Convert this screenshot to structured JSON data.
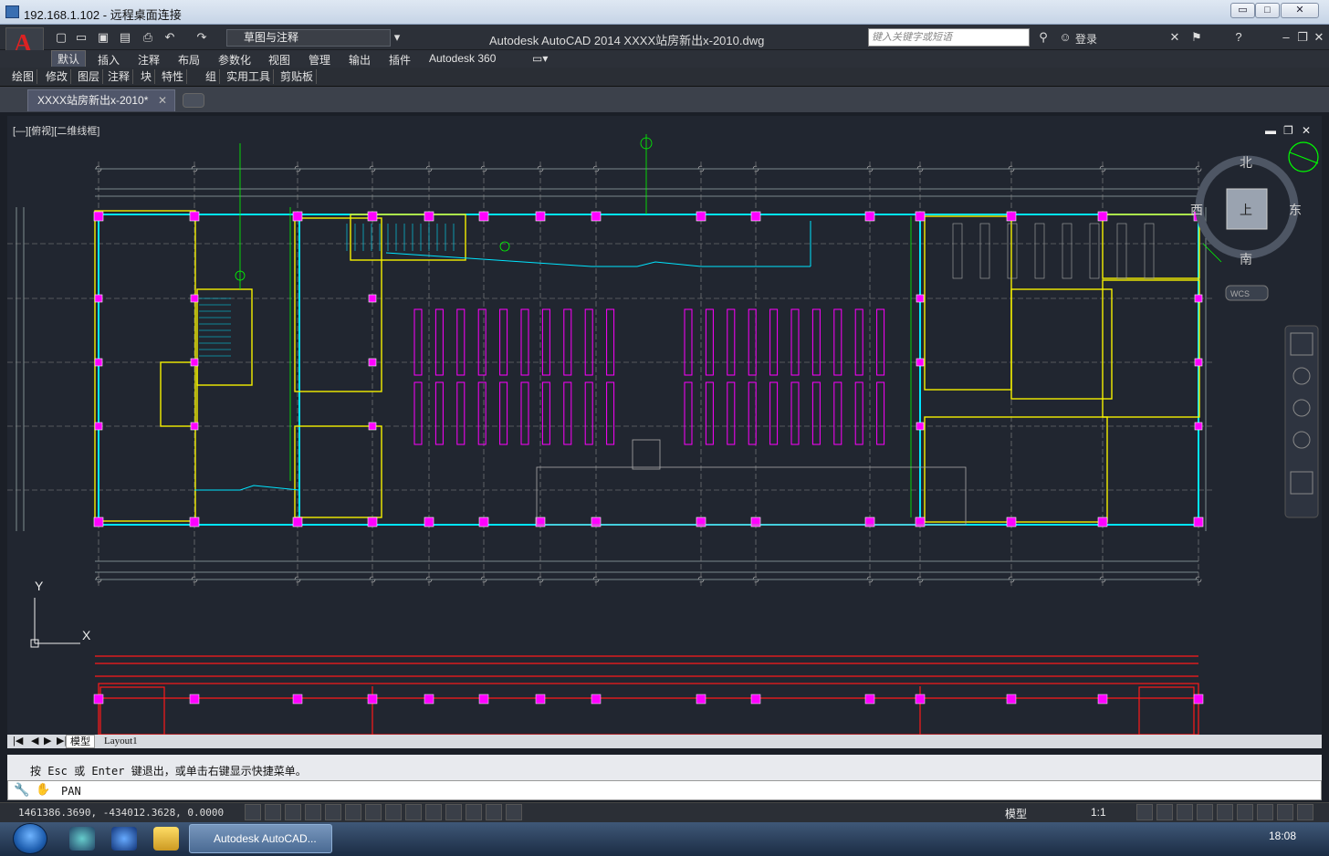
{
  "rdp": {
    "title": "192.168.1.102 - 远程桌面连接",
    "min": "▭",
    "restore": "□",
    "close": "✕"
  },
  "app": {
    "title": "Autodesk AutoCAD 2014    XXXX站房新出x-2010.dwg",
    "workspace": "草图与注释",
    "search_placeholder": "键入关键字或短语",
    "login": "登录",
    "logo_letter": "A"
  },
  "ribbon": {
    "tabs": [
      "默认",
      "插入",
      "注释",
      "布局",
      "参数化",
      "视图",
      "管理",
      "输出",
      "插件",
      "Autodesk 360"
    ],
    "active_tab": "默认",
    "panels": [
      "绘图",
      "修改",
      "图层",
      "注释",
      "块",
      "特性",
      "组",
      "实用工具",
      "剪贴板"
    ]
  },
  "document": {
    "tab_label": "XXXX站房新出x-2010*"
  },
  "viewport": {
    "label": "[—][俯视][二维线框]",
    "viewcube": {
      "north": "北",
      "south": "南",
      "east": "东",
      "west": "西",
      "top": "上",
      "wcs": "WCS"
    },
    "ucs": {
      "x": "X",
      "y": "Y"
    }
  },
  "layout_tabs": [
    "模型",
    "Layout1"
  ],
  "command": {
    "history": "按 Esc 或 Enter 键退出，或单击右键显示快捷菜单。",
    "current": "PAN"
  },
  "status": {
    "coords": "1461386.3690, -434012.3628, 0.0000",
    "model_label": "模型",
    "scale": "1:1"
  },
  "taskbar": {
    "acad_task": "Autodesk AutoCAD...",
    "clock": "18:08"
  },
  "colors": {
    "cyan": "#00e5ff",
    "yellow": "#f5f000",
    "magenta": "#ff00ff",
    "green": "#00ff00",
    "red": "#ff1a1a",
    "white": "#e8e8e8",
    "grey": "#8a8a8a"
  }
}
